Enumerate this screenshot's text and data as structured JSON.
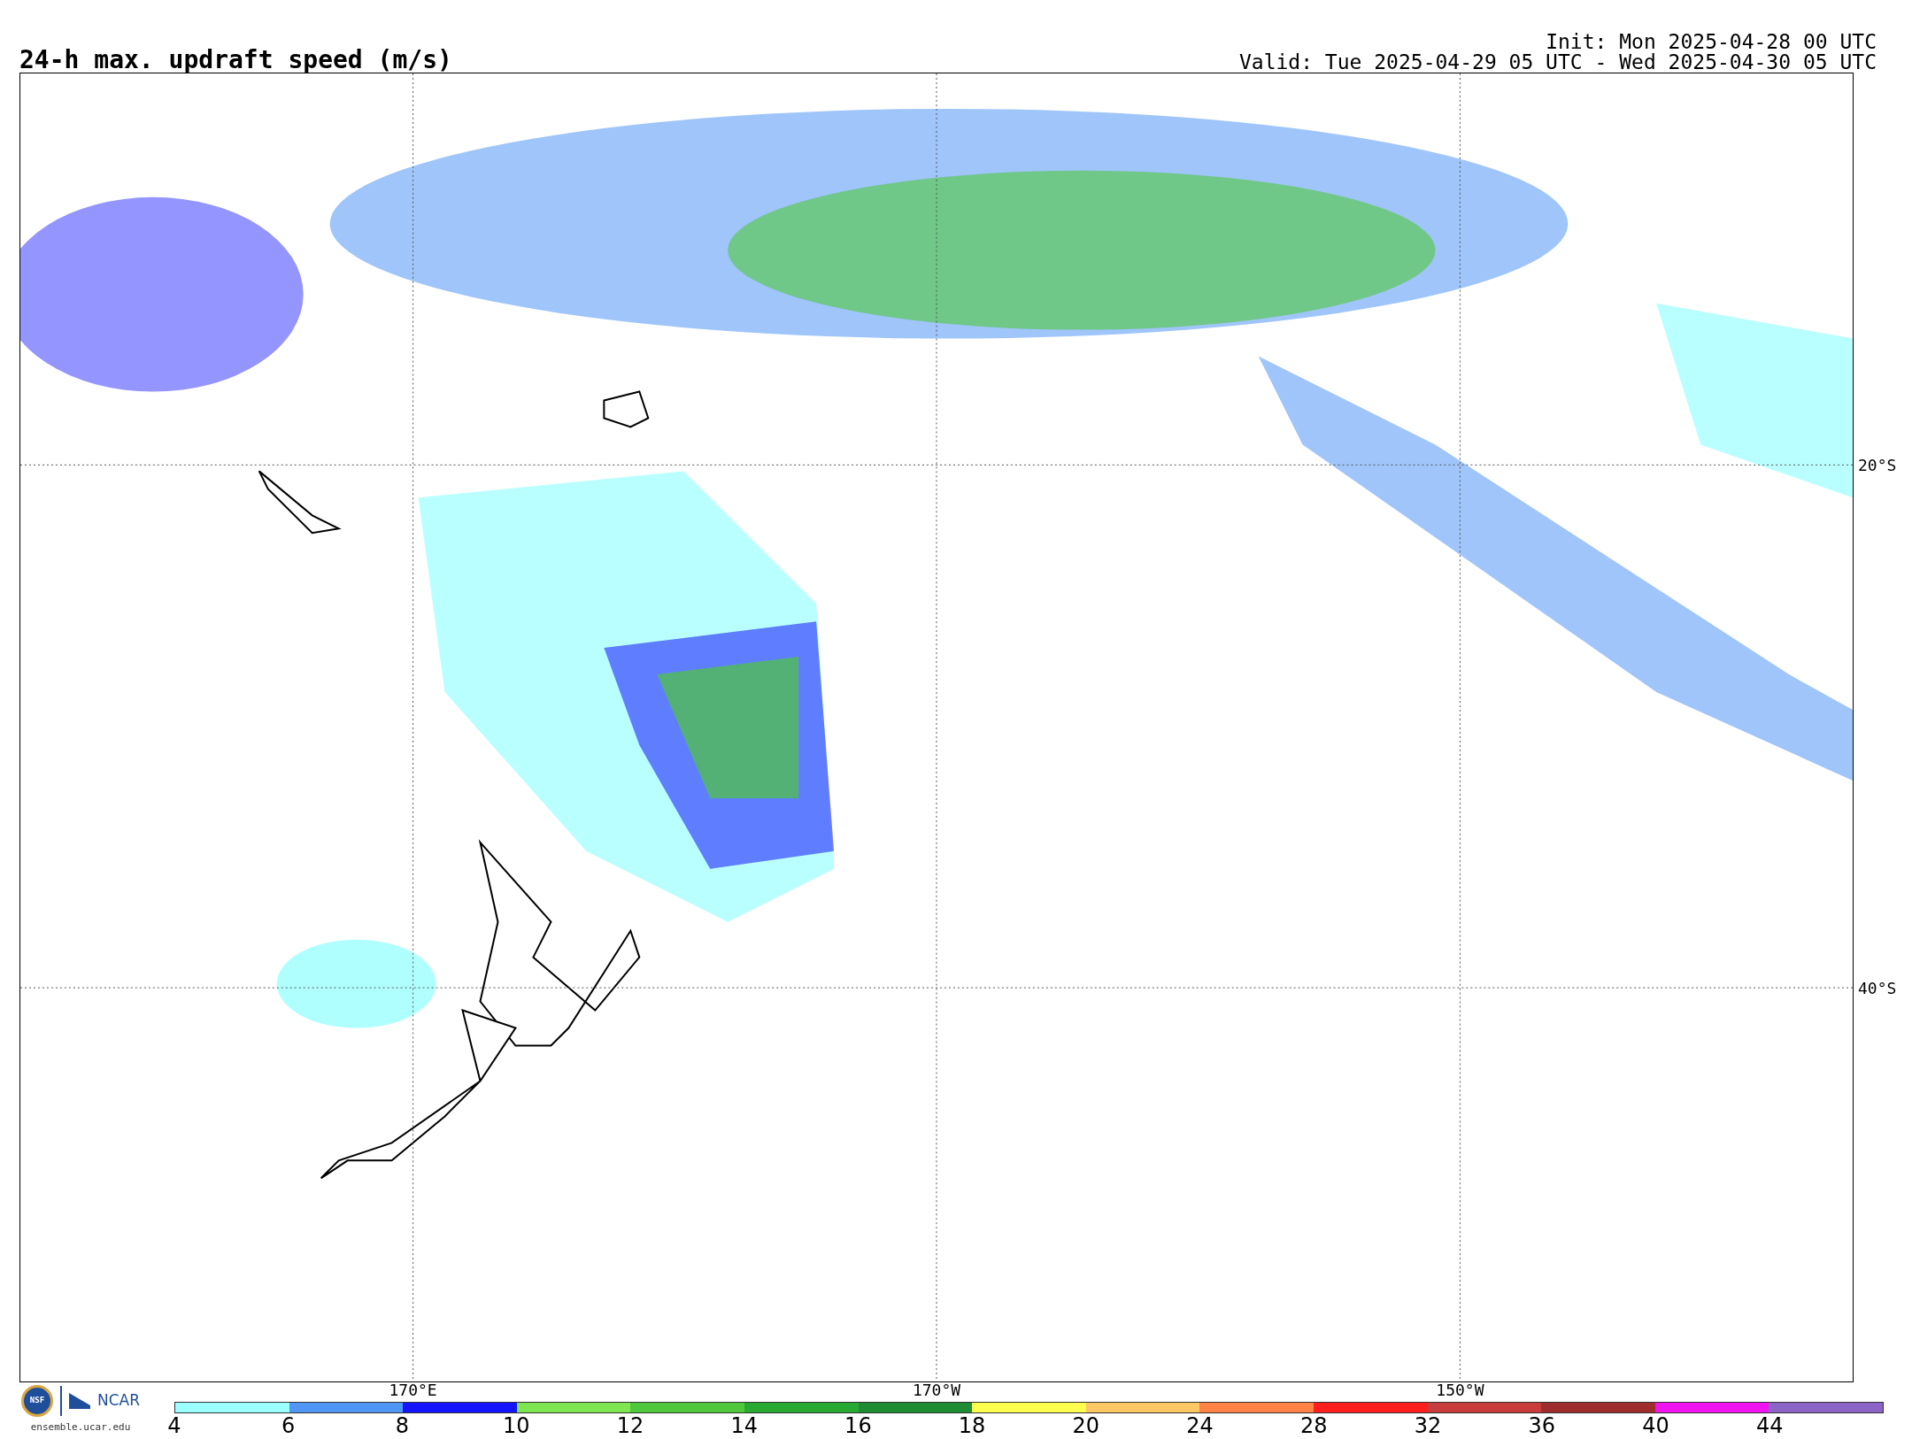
{
  "title": "24-h max. updraft speed (m/s)",
  "init": "Init: Mon 2025-04-28 00 UTC",
  "valid": "Valid: Tue 2025-04-29 05 UTC - Wed 2025-04-30 05 UTC",
  "map": {
    "lat_labels": [
      "20°S",
      "40°S"
    ],
    "lon_labels": [
      "170°E",
      "170°W",
      "150°W"
    ]
  },
  "logo": {
    "seal_text": "NSF",
    "name": "NCAR",
    "url": "ensemble.ucar.edu"
  },
  "colorbar": {
    "ticks": [
      "4",
      "6",
      "8",
      "10",
      "12",
      "14",
      "16",
      "18",
      "20",
      "24",
      "28",
      "32",
      "36",
      "40",
      "44"
    ],
    "bins": [
      {
        "color": "#9bffff"
      },
      {
        "color": "#5096f5"
      },
      {
        "color": "#1414ff"
      },
      {
        "color": "#7de650"
      },
      {
        "color": "#50c83c"
      },
      {
        "color": "#28aa32"
      },
      {
        "color": "#1e8c32"
      },
      {
        "color": "#ffff50"
      },
      {
        "color": "#ffc864"
      },
      {
        "color": "#ff8246"
      },
      {
        "color": "#ff1e1e"
      },
      {
        "color": "#c83c3c"
      },
      {
        "color": "#a02d2d"
      },
      {
        "color": "#f014f0"
      },
      {
        "color": "#8c64c8"
      }
    ]
  }
}
